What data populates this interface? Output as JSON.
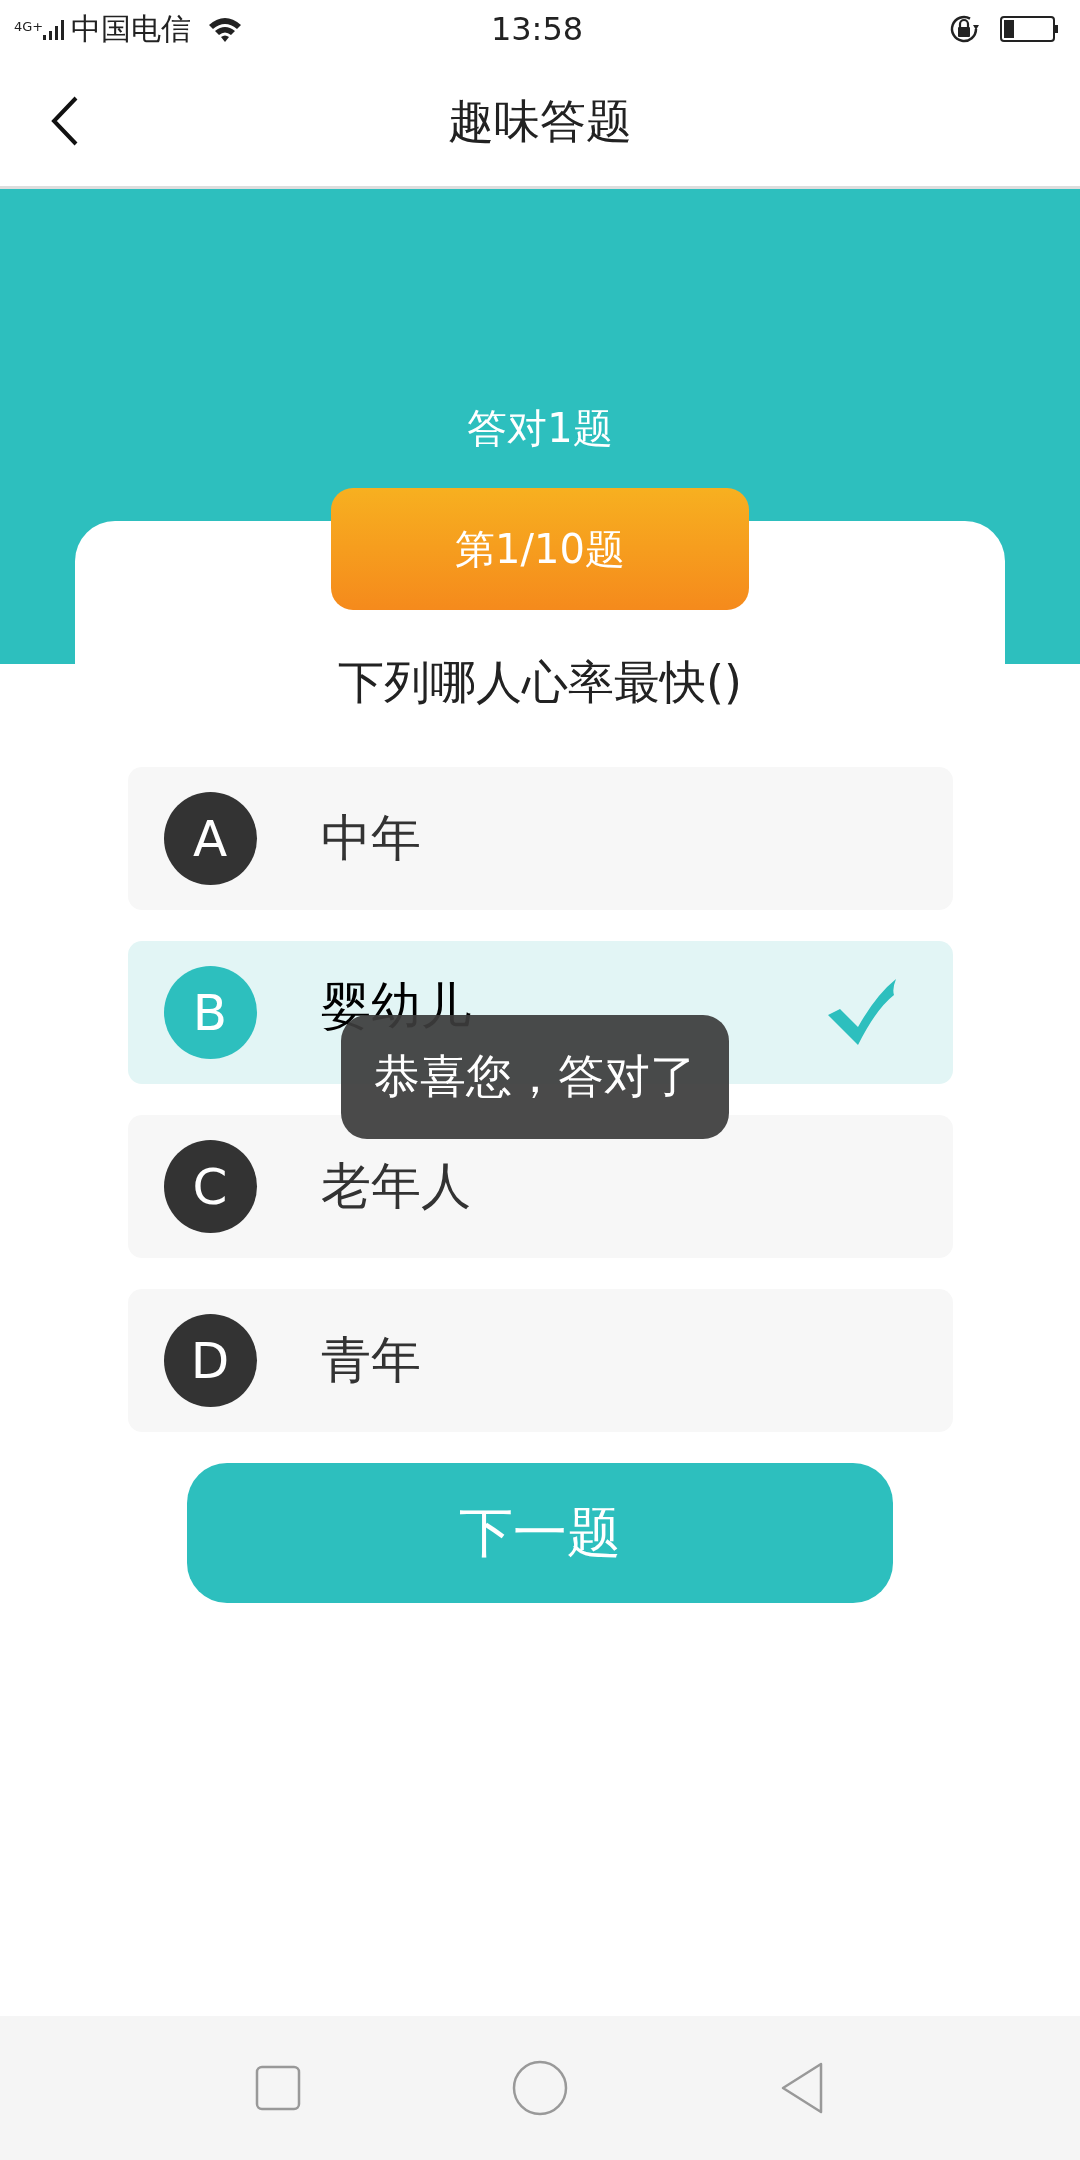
{
  "status_bar": {
    "network": "4G+",
    "carrier": "中国电信",
    "time": "13:58"
  },
  "header": {
    "title": "趣味答题"
  },
  "score": "答对1题",
  "progress": "第1/10题",
  "question": "下列哪人心率最快()",
  "options": [
    {
      "letter": "A",
      "text": "中年",
      "selected": false
    },
    {
      "letter": "B",
      "text": "婴幼儿",
      "selected": true
    },
    {
      "letter": "C",
      "text": "老年人",
      "selected": false
    },
    {
      "letter": "D",
      "text": "青年",
      "selected": false
    }
  ],
  "toast": "恭喜您，答对了",
  "next_button": "下一题"
}
